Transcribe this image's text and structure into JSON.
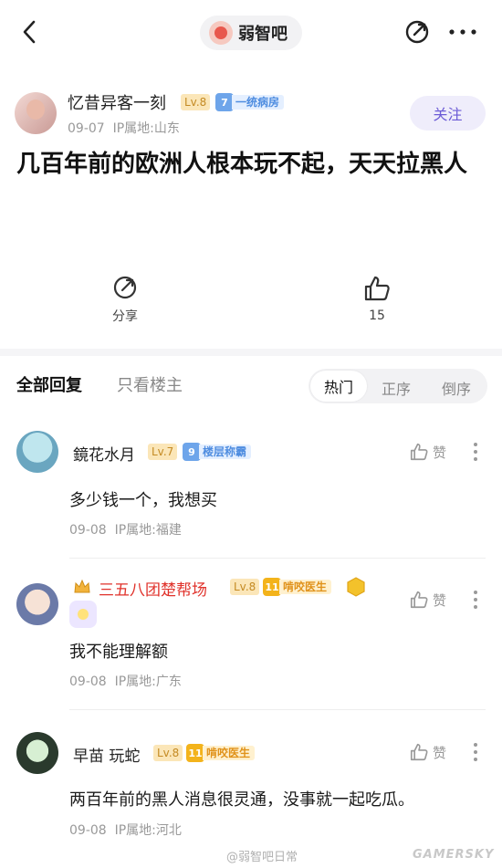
{
  "topbar": {
    "forum_name": "弱智吧"
  },
  "post": {
    "author": "忆昔异客一刻",
    "level": "Lv.8",
    "tag_num": "7",
    "tag_text": "一统病房",
    "date": "09-07",
    "ip": "IP属地:山东",
    "follow_label": "关注",
    "title": "几百年前的欧洲人根本玩不起，天天拉黑人",
    "share_label": "分享",
    "like_count": "15"
  },
  "filters": {
    "all_replies": "全部回复",
    "op_only": "只看楼主",
    "sort_hot": "热门",
    "sort_asc": "正序",
    "sort_desc": "倒序"
  },
  "comments": [
    {
      "name": "鏡花水月",
      "level": "Lv.7",
      "tag_num": "9",
      "tag_text": "楼层称霸",
      "text": "多少钱一个，我想买",
      "date": "09-08",
      "ip": "IP属地:福建",
      "like_label": "赞"
    },
    {
      "name": "三五八团楚帮场",
      "level": "Lv.8",
      "tag_num": "11",
      "tag_text": "啃咬医生",
      "text": "我不能理解额",
      "date": "09-08",
      "ip": "IP属地:广东",
      "like_label": "赞"
    },
    {
      "name": "早苗 玩蛇",
      "level": "Lv.8",
      "tag_num": "11",
      "tag_text": "啃咬医生",
      "text": "两百年前的黑人消息很灵通，没事就一起吃瓜。",
      "date": "09-08",
      "ip": "IP属地:河北",
      "like_label": "赞"
    }
  ],
  "watermark": "@弱智吧日常",
  "watermark_brand": "GAMERSKY",
  "colors": {
    "accent": "#6b5bd6",
    "level_badge": "#c48a23",
    "vip_name": "#e0322b"
  }
}
